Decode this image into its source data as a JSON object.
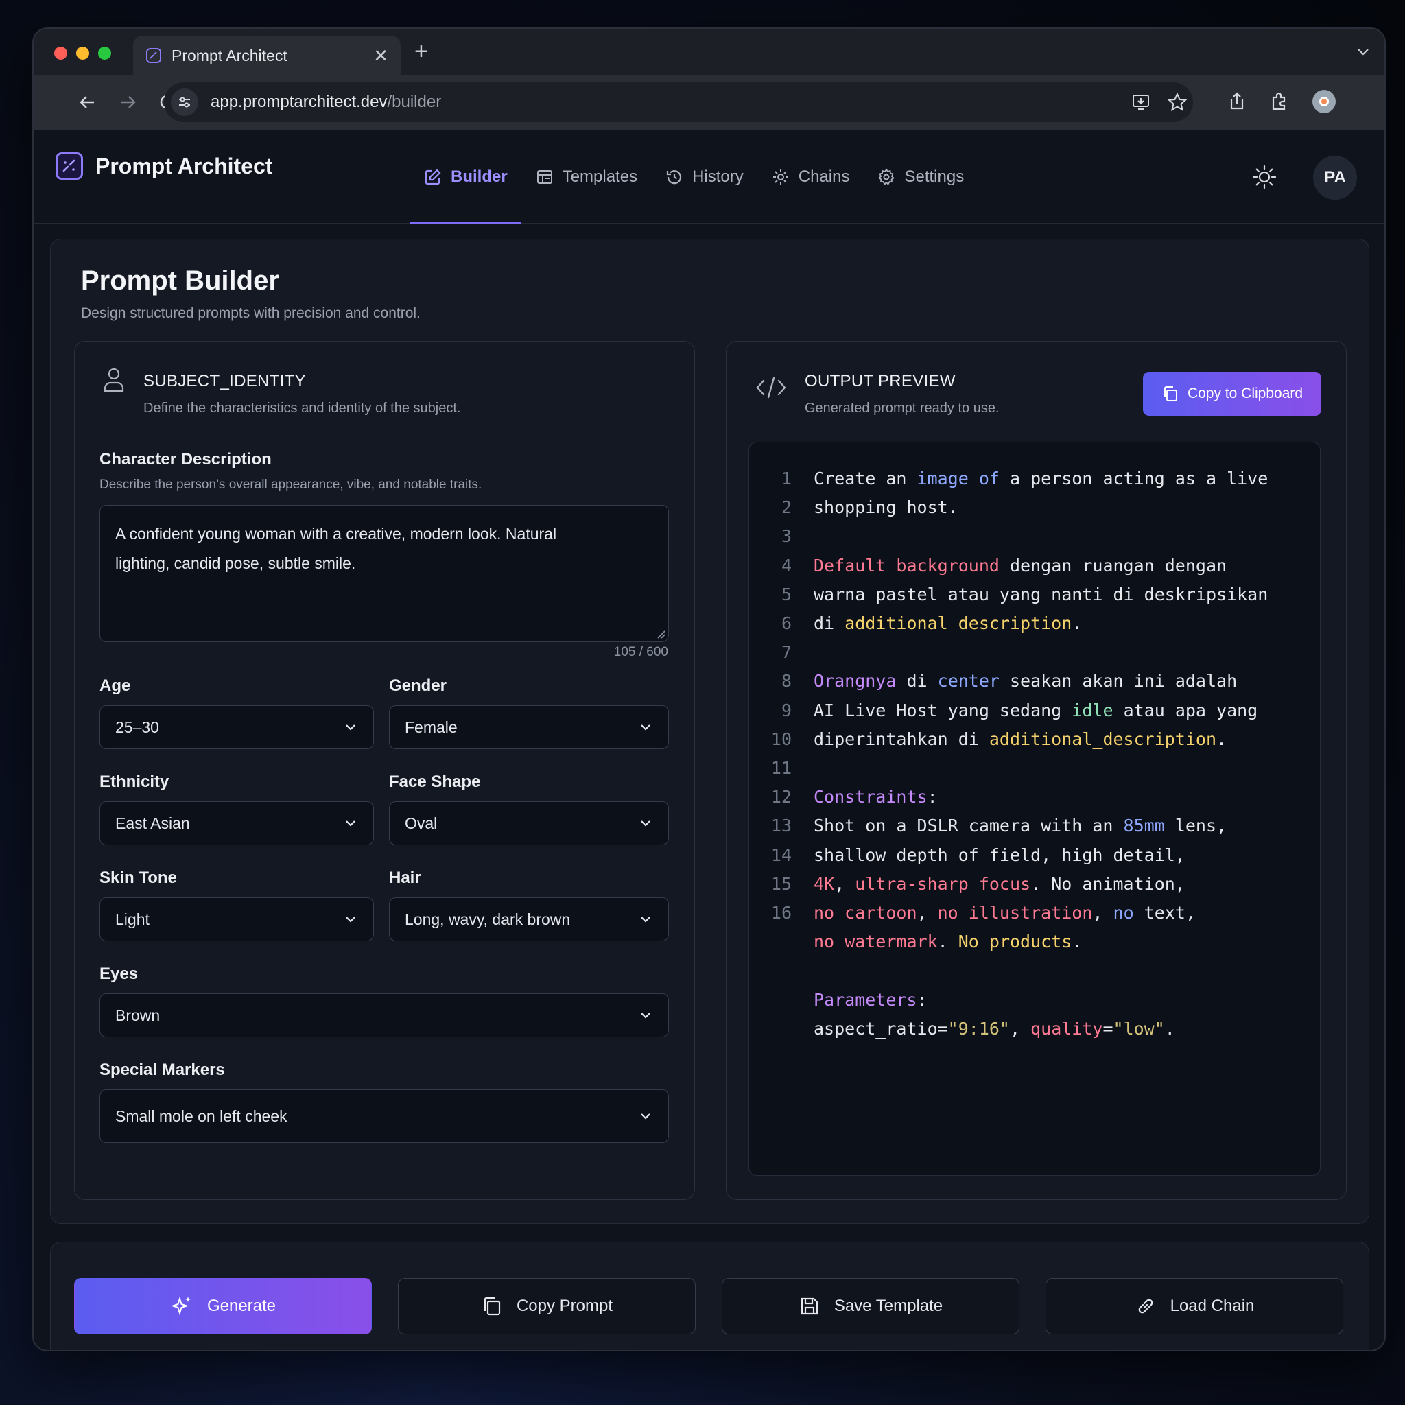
{
  "browser": {
    "tab_title": "Prompt Architect",
    "url_host": "app.promptarchitect.dev",
    "url_path": "/builder"
  },
  "app": {
    "name": "Prompt Architect",
    "nav": [
      {
        "label": "Builder",
        "icon": "pencil-square-icon",
        "active": true
      },
      {
        "label": "Templates",
        "icon": "template-icon",
        "active": false
      },
      {
        "label": "History",
        "icon": "clock-icon",
        "active": false
      },
      {
        "label": "Chains",
        "icon": "cog-chain-icon",
        "active": false
      },
      {
        "label": "Settings",
        "icon": "gear-icon",
        "active": false
      }
    ],
    "avatar_initials": "PA"
  },
  "page": {
    "title": "Prompt Builder",
    "subtitle": "Design structured prompts with precision and control."
  },
  "subject": {
    "title": "SUBJECT_IDENTITY",
    "subtitle": "Define the characteristics and identity of the subject.",
    "char_label": "Character Description",
    "char_hint": "Describe the person’s overall appearance, vibe, and notable traits.",
    "char_value_line1": "A confident young woman with a creative, modern look. Natural",
    "char_value_line2": "lighting, candid pose, subtle smile.",
    "char_count": "105 / 600",
    "fields": {
      "age": {
        "label": "Age",
        "value": "25–30"
      },
      "gender": {
        "label": "Gender",
        "value": "Female"
      },
      "ethnicity": {
        "label": "Ethnicity",
        "value": "East Asian"
      },
      "face_shape": {
        "label": "Face Shape",
        "value": "Oval"
      },
      "skin_tone": {
        "label": "Skin Tone",
        "value": "Light"
      },
      "hair": {
        "label": "Hair",
        "value": "Long, wavy, dark brown"
      },
      "eyes": {
        "label": "Eyes",
        "value": "Brown"
      },
      "special_markers": {
        "label": "Special Markers",
        "value": "Small mole on left cheek"
      }
    }
  },
  "output": {
    "title": "OUTPUT PREVIEW",
    "subtitle": "Generated prompt ready to use.",
    "copy_label": "Copy to Clipboard",
    "line_numbers": [
      "1",
      "2",
      "3",
      "4",
      "5",
      "6",
      "7",
      "8",
      "9",
      "10",
      "11",
      "12",
      "13",
      "14",
      "15",
      "16"
    ],
    "lines": [
      [
        [
          "w",
          "Create an "
        ],
        [
          "b",
          "image"
        ],
        [
          "w",
          " "
        ],
        [
          "b",
          "of"
        ],
        [
          "w",
          " a person acting as a live"
        ]
      ],
      [
        [
          "w",
          "shopping host."
        ]
      ],
      [],
      [
        [
          "p",
          "Default background"
        ],
        [
          "w",
          " dengan ruangan dengan"
        ]
      ],
      [
        [
          "w",
          "warna pastel atau yang nanti di deskripsikan"
        ]
      ],
      [
        [
          "w",
          "di "
        ],
        [
          "y",
          "additional_description"
        ],
        [
          "w",
          "."
        ]
      ],
      [],
      [
        [
          "u",
          "Orangnya"
        ],
        [
          "w",
          " di "
        ],
        [
          "b",
          "center"
        ],
        [
          "w",
          " seakan akan ini adalah"
        ]
      ],
      [
        [
          "w",
          "AI Live Host yang sedang "
        ],
        [
          "g",
          "idle"
        ],
        [
          "w",
          " atau apa yang"
        ]
      ],
      [
        [
          "w",
          "diperintahkan di "
        ],
        [
          "y",
          "additional_description"
        ],
        [
          "w",
          "."
        ]
      ],
      [],
      [
        [
          "u",
          "Constraints"
        ],
        [
          "w",
          ":"
        ]
      ],
      [
        [
          "w",
          "Shot on a DSLR camera with an "
        ],
        [
          "b",
          "85mm"
        ],
        [
          "w",
          " lens,"
        ]
      ],
      [
        [
          "w",
          "shallow depth of field, high detail,"
        ]
      ],
      [
        [
          "p",
          "4K"
        ],
        [
          "w",
          ", "
        ],
        [
          "p",
          "ultra-sharp focus"
        ],
        [
          "w",
          ". No animation,"
        ]
      ],
      [
        [
          "p",
          "no cartoon"
        ],
        [
          "w",
          ", "
        ],
        [
          "p",
          "no illustration"
        ],
        [
          "w",
          ", "
        ],
        [
          "b",
          "no"
        ],
        [
          "w",
          " text,"
        ]
      ],
      [
        [
          "p",
          "no watermark"
        ],
        [
          "w",
          ". "
        ],
        [
          "y",
          "No products"
        ],
        [
          "w",
          "."
        ]
      ],
      [],
      [
        [
          "u",
          "Parameters"
        ],
        [
          "w",
          ":"
        ]
      ],
      [
        [
          "w",
          "aspect_ratio="
        ],
        [
          "s",
          "\"9:16\""
        ],
        [
          "w",
          ", "
        ],
        [
          "p",
          "quality"
        ],
        [
          "w",
          "="
        ],
        [
          "s",
          "\"low\""
        ],
        [
          "w",
          "."
        ]
      ]
    ]
  },
  "actions": {
    "generate": "Generate",
    "copy_prompt": "Copy Prompt",
    "save_template": "Save Template",
    "load_chain": "Load Chain"
  },
  "colors": {
    "accent": "#7c6cf6",
    "accent_gradient_start": "#5b5df0",
    "accent_gradient_end": "#8a4fe9"
  }
}
